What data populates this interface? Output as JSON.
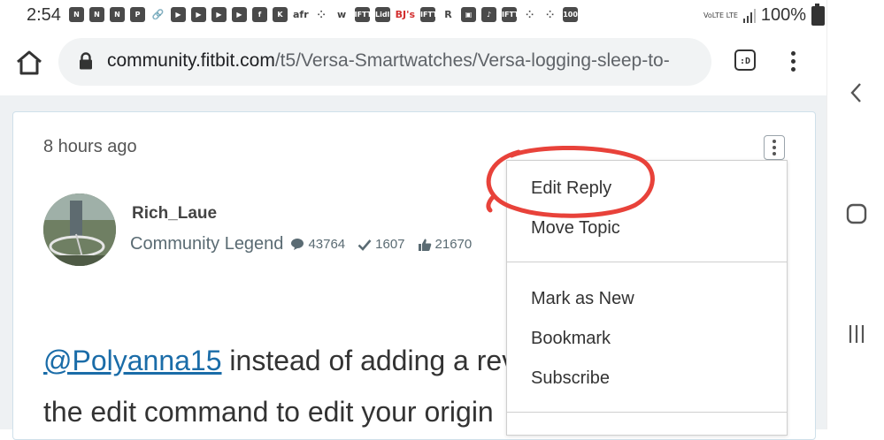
{
  "status_bar": {
    "time": "2:54",
    "notification_icons": [
      "N",
      "N",
      "N",
      "P",
      "link",
      "▶",
      "▶",
      "▶",
      "▶",
      "f",
      "K",
      "afr",
      "⁘",
      "w",
      "IFTTT",
      "Lidl",
      "BJ's",
      "IFTTT",
      "R",
      "img",
      "♪",
      "IFTTT",
      "⁘",
      "⁘",
      "100"
    ],
    "network": "VoLTE LTE",
    "battery_percent": "100%"
  },
  "browser": {
    "url_host": "community.fitbit.com",
    "url_path": "/t5/Versa-Smartwatches/Versa-logging-sleep-to-",
    "tab_count": ":D"
  },
  "post": {
    "timestamp": "8 hours ago",
    "author": "Rich_Laue",
    "rank": "Community Legend",
    "stats": {
      "posts": "43764",
      "solutions": "1607",
      "kudos": "21670"
    },
    "mention": "@Polyanna15",
    "line1_rest": " instead of adding a rev",
    "line2": "the edit command to edit your origin"
  },
  "dropdown": {
    "group1": [
      "Edit Reply",
      "Move Topic"
    ],
    "group2": [
      "Mark as New",
      "Bookmark",
      "Subscribe"
    ]
  },
  "colors": {
    "annotation": "#e8423a",
    "link": "#1a6ca8",
    "page_bg": "#eef1f3"
  }
}
